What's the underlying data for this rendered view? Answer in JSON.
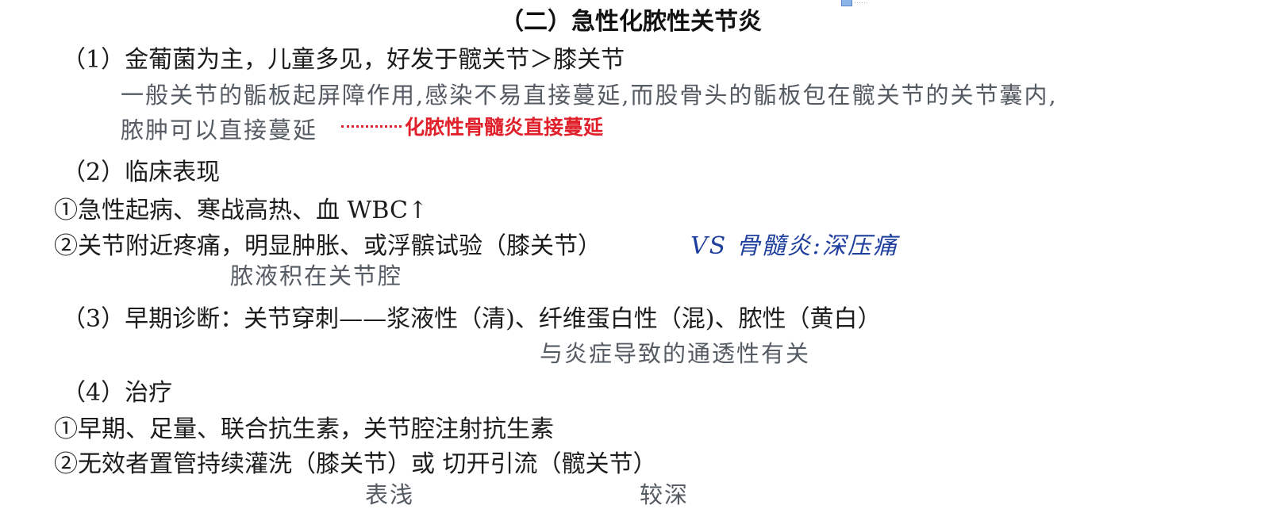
{
  "header": {
    "title": "（二）急性化脓性关节炎",
    "top_right_text": "……"
  },
  "sections": {
    "s1": {
      "heading": "（1）金葡菌为主，儿童多见，好发于髋关节＞膝关节",
      "note_line1": "一般关节的骺板起屏障作用,感染不易直接蔓延,而股骨头的骺板包在髋关节的关节囊内,",
      "note_line2": "脓肿可以直接蔓延",
      "red_note": "化脓性骨髓炎直接蔓延"
    },
    "s2": {
      "heading": "（2）临床表现",
      "item1": "①急性起病、寒战高热、血 WBC↑",
      "item2": "②关节附近疼痛，明显肿胀、或浮髌试验（膝关节）",
      "vs_note": "VS  骨髓炎:深压痛",
      "note": "脓液积在关节腔"
    },
    "s3": {
      "heading": "（3）早期诊断：关节穿刺——浆液性（清)、纤维蛋白性（混)、脓性（黄白）",
      "note": "与炎症导致的通透性有关"
    },
    "s4": {
      "heading": "（4）治疗",
      "item1": "①早期、足量、联合抗生素，关节腔注射抗生素",
      "item2": "②无效者置管持续灌洗（膝关节）或 切开引流（髋关节）",
      "note_left": "表浅",
      "note_right": "较深"
    }
  }
}
